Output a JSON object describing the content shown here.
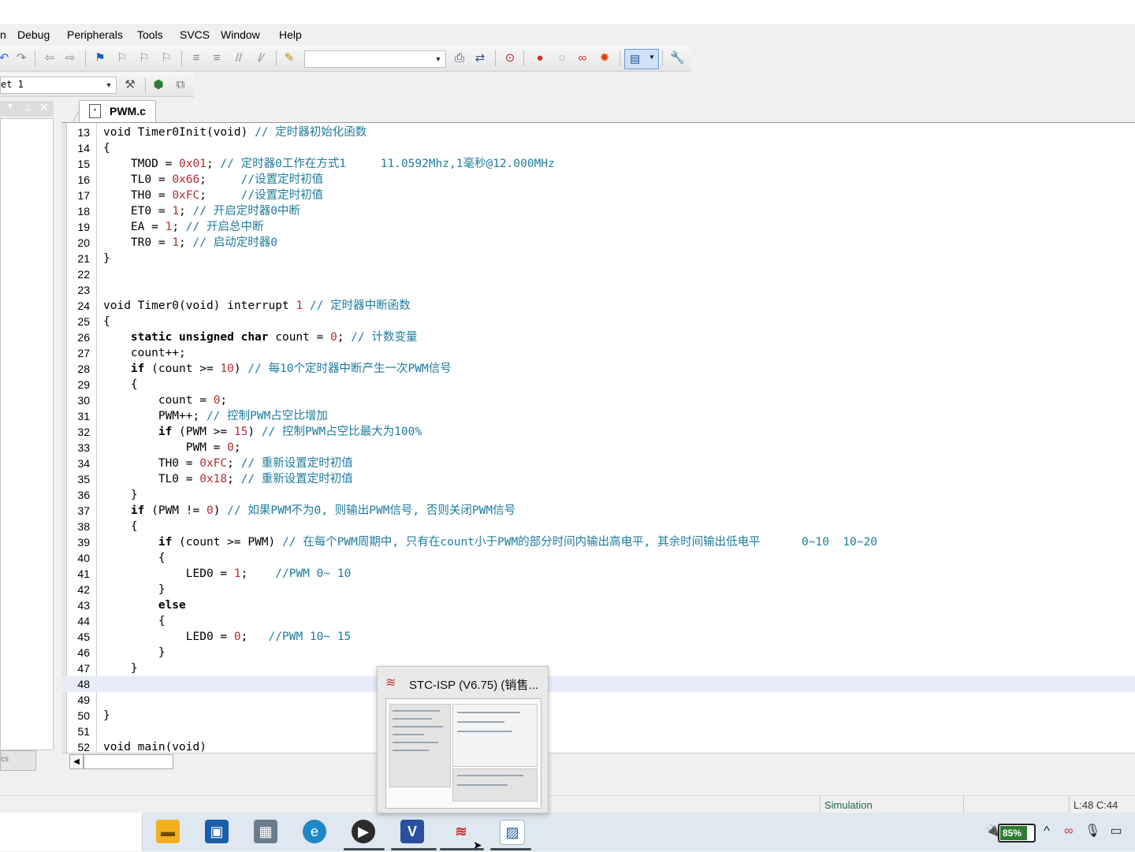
{
  "menu": {
    "partial_first": "n",
    "items": [
      {
        "label": "Debug"
      },
      {
        "label": "Peripherals"
      },
      {
        "label": "Tools"
      },
      {
        "label": "SVCS"
      },
      {
        "label": "Window"
      },
      {
        "label": "Help"
      }
    ]
  },
  "toolbar": {
    "target_combo_value": "et 1",
    "icons": [
      "undo-icon",
      "redo-icon",
      "nav-back-icon",
      "nav-forward-icon",
      "bookmark-icon",
      "bookmark-prev-icon",
      "bookmark-next-icon",
      "bookmark-clear-icon",
      "indent-icon",
      "unindent-icon",
      "comment-icon",
      "uncomment-icon",
      "find-in-files-icon",
      "find-combo",
      "find-icon",
      "replace-icon",
      "debug-start-icon",
      "breakpoint-insert-icon",
      "breakpoint-disable-icon",
      "breakpoint-kill-icon",
      "breakpoint-clear-icon",
      "window-layout-icon",
      "configure-icon"
    ]
  },
  "left_panel": {
    "tab_label": "cs"
  },
  "editor": {
    "tab_label": "PWM.c",
    "current_line": 48,
    "lines": [
      {
        "n": "13",
        "segs": [
          [
            "kw0",
            "void Timer0Init(void) "
          ],
          [
            "cmt",
            "// 定时器初始化函数"
          ]
        ]
      },
      {
        "n": "14",
        "segs": [
          [
            "t",
            "{"
          ]
        ]
      },
      {
        "n": "15",
        "segs": [
          [
            "t",
            "    TMOD = "
          ],
          [
            "num",
            "0x01"
          ],
          [
            "t",
            "; "
          ],
          [
            "cmt",
            "// 定时器0工作在方式1     11.0592Mhz,1毫秒@12.000MHz"
          ]
        ]
      },
      {
        "n": "16",
        "segs": [
          [
            "t",
            "    TL0 = "
          ],
          [
            "num",
            "0x66"
          ],
          [
            "t",
            ";     "
          ],
          [
            "cmt",
            "//设置定时初值"
          ]
        ]
      },
      {
        "n": "17",
        "segs": [
          [
            "t",
            "    TH0 = "
          ],
          [
            "num",
            "0xFC"
          ],
          [
            "t",
            ";     "
          ],
          [
            "cmt",
            "//设置定时初值"
          ]
        ]
      },
      {
        "n": "18",
        "segs": [
          [
            "t",
            "    ET0 = "
          ],
          [
            "num",
            "1"
          ],
          [
            "t",
            "; "
          ],
          [
            "cmt",
            "// 开启定时器0中断"
          ]
        ]
      },
      {
        "n": "19",
        "segs": [
          [
            "t",
            "    EA = "
          ],
          [
            "num",
            "1"
          ],
          [
            "t",
            "; "
          ],
          [
            "cmt",
            "// 开启总中断"
          ]
        ]
      },
      {
        "n": "20",
        "segs": [
          [
            "t",
            "    TR0 = "
          ],
          [
            "num",
            "1"
          ],
          [
            "t",
            "; "
          ],
          [
            "cmt",
            "// 启动定时器0"
          ]
        ]
      },
      {
        "n": "21",
        "segs": [
          [
            "t",
            "}"
          ]
        ]
      },
      {
        "n": "22",
        "segs": []
      },
      {
        "n": "23",
        "segs": []
      },
      {
        "n": "24",
        "segs": [
          [
            "t",
            "void Timer0(void) interrupt "
          ],
          [
            "num",
            "1"
          ],
          [
            "t",
            " "
          ],
          [
            "cmt",
            "// 定时器中断函数"
          ]
        ]
      },
      {
        "n": "25",
        "segs": [
          [
            "t",
            "{"
          ]
        ]
      },
      {
        "n": "26",
        "segs": [
          [
            "kw",
            "    static unsigned char"
          ],
          [
            "t",
            " count = "
          ],
          [
            "num",
            "0"
          ],
          [
            "t",
            "; "
          ],
          [
            "cmt",
            "// 计数变量"
          ]
        ]
      },
      {
        "n": "27",
        "segs": [
          [
            "t",
            "    count++;"
          ]
        ]
      },
      {
        "n": "28",
        "segs": [
          [
            "kw",
            "    if"
          ],
          [
            "t",
            " (count >= "
          ],
          [
            "num",
            "10"
          ],
          [
            "t",
            ") "
          ],
          [
            "cmt",
            "// 每10个定时器中断产生一次PWM信号"
          ]
        ]
      },
      {
        "n": "29",
        "segs": [
          [
            "t",
            "    {"
          ]
        ]
      },
      {
        "n": "30",
        "segs": [
          [
            "t",
            "        count = "
          ],
          [
            "num",
            "0"
          ],
          [
            "t",
            ";"
          ]
        ]
      },
      {
        "n": "31",
        "segs": [
          [
            "t",
            "        PWM++; "
          ],
          [
            "cmt",
            "// 控制PWM占空比增加"
          ]
        ]
      },
      {
        "n": "32",
        "segs": [
          [
            "kw",
            "        if"
          ],
          [
            "t",
            " (PWM >= "
          ],
          [
            "num",
            "15"
          ],
          [
            "t",
            ") "
          ],
          [
            "cmt",
            "// 控制PWM占空比最大为100%"
          ]
        ]
      },
      {
        "n": "33",
        "segs": [
          [
            "t",
            "            PWM = "
          ],
          [
            "num",
            "0"
          ],
          [
            "t",
            ";"
          ]
        ]
      },
      {
        "n": "34",
        "segs": [
          [
            "t",
            "        TH0 = "
          ],
          [
            "num",
            "0xFC"
          ],
          [
            "t",
            "; "
          ],
          [
            "cmt",
            "// 重新设置定时初值"
          ]
        ]
      },
      {
        "n": "35",
        "segs": [
          [
            "t",
            "        TL0 = "
          ],
          [
            "num",
            "0x18"
          ],
          [
            "t",
            "; "
          ],
          [
            "cmt",
            "// 重新设置定时初值"
          ]
        ]
      },
      {
        "n": "36",
        "segs": [
          [
            "t",
            "    }"
          ]
        ]
      },
      {
        "n": "37",
        "segs": [
          [
            "kw",
            "    if"
          ],
          [
            "t",
            " (PWM != "
          ],
          [
            "num",
            "0"
          ],
          [
            "t",
            ") "
          ],
          [
            "cmt",
            "// 如果PWM不为0, 则输出PWM信号, 否则关闭PWM信号"
          ]
        ]
      },
      {
        "n": "38",
        "segs": [
          [
            "t",
            "    {"
          ]
        ]
      },
      {
        "n": "39",
        "segs": [
          [
            "kw",
            "        if"
          ],
          [
            "t",
            " (count >= PWM) "
          ],
          [
            "cmt",
            "// 在每个PWM周期中, 只有在count小于PWM的部分时间内输出高电平, 其余时间输出低电平      0~10  10~20"
          ]
        ]
      },
      {
        "n": "40",
        "segs": [
          [
            "t",
            "        {"
          ]
        ]
      },
      {
        "n": "41",
        "segs": [
          [
            "t",
            "            LED0 = "
          ],
          [
            "num",
            "1"
          ],
          [
            "t",
            ";    "
          ],
          [
            "cmt",
            "//PWM 0~ 10"
          ]
        ]
      },
      {
        "n": "42",
        "segs": [
          [
            "t",
            "        }"
          ]
        ]
      },
      {
        "n": "43",
        "segs": [
          [
            "kw",
            "        else"
          ]
        ]
      },
      {
        "n": "44",
        "segs": [
          [
            "t",
            "        {"
          ]
        ]
      },
      {
        "n": "45",
        "segs": [
          [
            "t",
            "            LED0 = "
          ],
          [
            "num",
            "0"
          ],
          [
            "t",
            ";   "
          ],
          [
            "cmt",
            "//PWM 10~ 15"
          ]
        ]
      },
      {
        "n": "46",
        "segs": [
          [
            "t",
            "        }"
          ]
        ]
      },
      {
        "n": "47",
        "segs": [
          [
            "t",
            "    }"
          ]
        ]
      },
      {
        "n": "48",
        "segs": []
      },
      {
        "n": "49",
        "segs": []
      },
      {
        "n": "50",
        "segs": [
          [
            "t",
            "}"
          ]
        ]
      },
      {
        "n": "51",
        "segs": []
      },
      {
        "n": "52",
        "segs": [
          [
            "kw0",
            "void main(void)"
          ]
        ]
      }
    ]
  },
  "status_bar": {
    "mode": "Simulation",
    "cursor_pos": "L:48 C:44"
  },
  "taskbar_preview": {
    "title": "STC-ISP (V6.75) (销售..."
  },
  "taskbar": {
    "apps": [
      "file-explorer-icon",
      "photos-icon",
      "calculator-icon",
      "edge-browser-icon",
      "media-player-icon",
      "keil-uvision-icon",
      "stc-isp-icon",
      "image-viewer-icon"
    ],
    "battery_percent": "85%"
  },
  "colors": {
    "comment": "#1e7c9e",
    "number": "#b03030",
    "current_line": "#e8ecfa",
    "status_green": "#1c6a4a"
  }
}
